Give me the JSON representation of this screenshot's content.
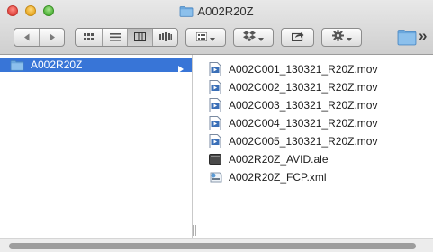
{
  "window": {
    "title": "A002R20Z"
  },
  "toolbar": {
    "back_icon": "chevron-left-icon",
    "forward_icon": "chevron-right-icon",
    "view_modes": [
      "icon-view-icon",
      "list-view-icon",
      "column-view-icon",
      "cover-flow-icon"
    ],
    "active_view": "column-view-icon",
    "arrange_icon": "arrange-icon",
    "dropbox_icon": "dropbox-icon",
    "share_icon": "share-icon",
    "action_icon": "gear-icon",
    "overflow_label": "»"
  },
  "sidebar": {
    "selected_folder": "A002R20Z"
  },
  "files": [
    {
      "name": "A002C001_130321_R20Z.mov",
      "icon": "movie-file-icon"
    },
    {
      "name": "A002C002_130321_R20Z.mov",
      "icon": "movie-file-icon"
    },
    {
      "name": "A002C003_130321_R20Z.mov",
      "icon": "movie-file-icon"
    },
    {
      "name": "A002C004_130321_R20Z.mov",
      "icon": "movie-file-icon"
    },
    {
      "name": "A002C005_130321_R20Z.mov",
      "icon": "movie-file-icon"
    },
    {
      "name": "A002R20Z_AVID.ale",
      "icon": "ale-file-icon"
    },
    {
      "name": "A002R20Z_FCP.xml",
      "icon": "xml-file-icon"
    }
  ],
  "colors": {
    "selection": "#3875d7",
    "folder": "#6aa7dd"
  }
}
